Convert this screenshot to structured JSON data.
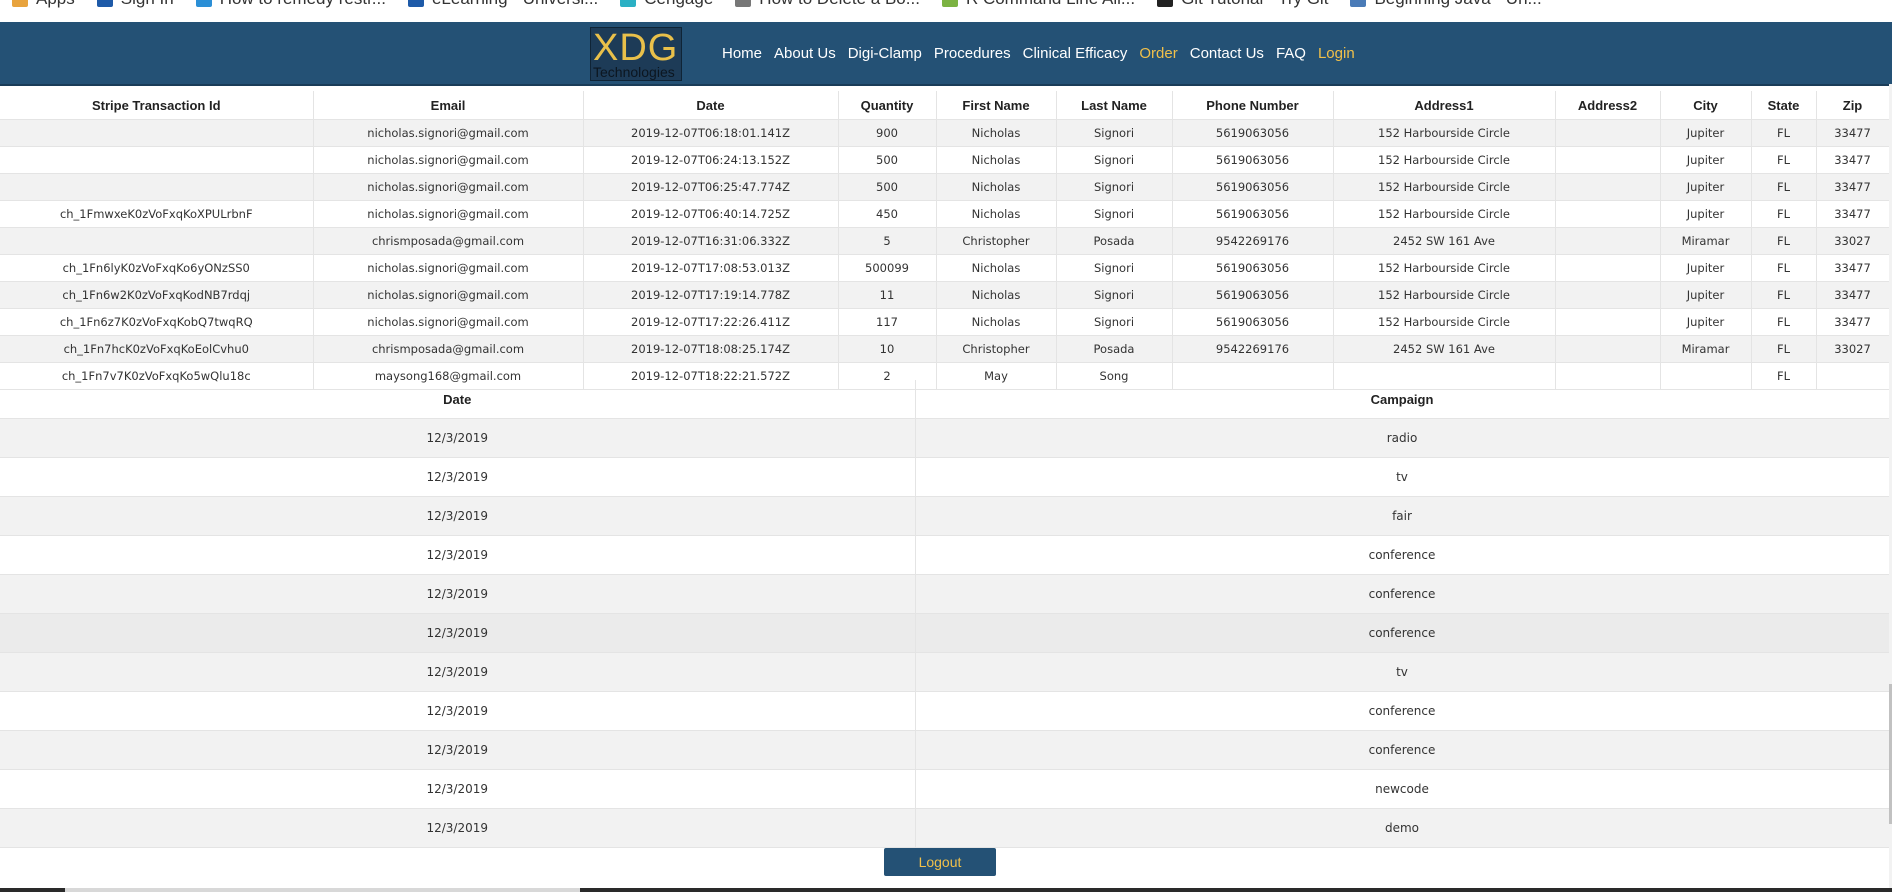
{
  "bookmarks": [
    {
      "label": "Apps",
      "icon": "apps-grid-icon",
      "color": "#e8a33d"
    },
    {
      "label": "Sign In",
      "icon": "sign-in-icon",
      "color": "#1e5aa8"
    },
    {
      "label": "How to remedy restr...",
      "icon": "windows-icon",
      "color": "#2b8fd6"
    },
    {
      "label": "eLearning - Universi...",
      "icon": "elearning-icon",
      "color": "#1e5aa8"
    },
    {
      "label": "Cengage",
      "icon": "cengage-icon",
      "color": "#2bb0c4"
    },
    {
      "label": "How to Delete a Bo...",
      "icon": "clock-icon",
      "color": "#777777"
    },
    {
      "label": "R Command Line All...",
      "icon": "chart-icon",
      "color": "#7cb342"
    },
    {
      "label": "Git Tutorial - Try Git",
      "icon": "github-icon",
      "color": "#222222"
    },
    {
      "label": "Beginning Java - Un...",
      "icon": "java-icon",
      "color": "#4a7bb7"
    }
  ],
  "navbar": {
    "logo_main": "XDG",
    "logo_sub": "Technologies",
    "links": [
      {
        "label": "Home",
        "active": false
      },
      {
        "label": "About Us",
        "active": false
      },
      {
        "label": "Digi-Clamp",
        "active": false
      },
      {
        "label": "Procedures",
        "active": false
      },
      {
        "label": "Clinical Efficacy",
        "active": false
      },
      {
        "label": "Order",
        "active": true
      },
      {
        "label": "Contact Us",
        "active": false
      },
      {
        "label": "FAQ",
        "active": false
      },
      {
        "label": "Login",
        "active": true
      }
    ],
    "colors": {
      "background": "#245175",
      "accent": "#f0c04a"
    }
  },
  "orders": {
    "headers": [
      "Stripe Transaction Id",
      "Email",
      "Date",
      "Quantity",
      "First Name",
      "Last Name",
      "Phone Number",
      "Address1",
      "Address2",
      "City",
      "State",
      "Zip"
    ],
    "rows": [
      [
        "",
        "nicholas.signori@gmail.com",
        "2019-12-07T06:18:01.141Z",
        "900",
        "Nicholas",
        "Signori",
        "5619063056",
        "152 Harbourside Circle",
        "",
        "Jupiter",
        "FL",
        "33477"
      ],
      [
        "",
        "nicholas.signori@gmail.com",
        "2019-12-07T06:24:13.152Z",
        "500",
        "Nicholas",
        "Signori",
        "5619063056",
        "152 Harbourside Circle",
        "",
        "Jupiter",
        "FL",
        "33477"
      ],
      [
        "",
        "nicholas.signori@gmail.com",
        "2019-12-07T06:25:47.774Z",
        "500",
        "Nicholas",
        "Signori",
        "5619063056",
        "152 Harbourside Circle",
        "",
        "Jupiter",
        "FL",
        "33477"
      ],
      [
        "ch_1FmwxeK0zVoFxqKoXPULrbnF",
        "nicholas.signori@gmail.com",
        "2019-12-07T06:40:14.725Z",
        "450",
        "Nicholas",
        "Signori",
        "5619063056",
        "152 Harbourside Circle",
        "",
        "Jupiter",
        "FL",
        "33477"
      ],
      [
        "",
        "chrismposada@gmail.com",
        "2019-12-07T16:31:06.332Z",
        "5",
        "Christopher",
        "Posada",
        "9542269176",
        "2452 SW 161 Ave",
        "",
        "Miramar",
        "FL",
        "33027"
      ],
      [
        "ch_1Fn6lyK0zVoFxqKo6yONzSS0",
        "nicholas.signori@gmail.com",
        "2019-12-07T17:08:53.013Z",
        "500099",
        "Nicholas",
        "Signori",
        "5619063056",
        "152 Harbourside Circle",
        "",
        "Jupiter",
        "FL",
        "33477"
      ],
      [
        "ch_1Fn6w2K0zVoFxqKodNB7rdqj",
        "nicholas.signori@gmail.com",
        "2019-12-07T17:19:14.778Z",
        "11",
        "Nicholas",
        "Signori",
        "5619063056",
        "152 Harbourside Circle",
        "",
        "Jupiter",
        "FL",
        "33477"
      ],
      [
        "ch_1Fn6z7K0zVoFxqKobQ7twqRQ",
        "nicholas.signori@gmail.com",
        "2019-12-07T17:22:26.411Z",
        "117",
        "Nicholas",
        "Signori",
        "5619063056",
        "152 Harbourside Circle",
        "",
        "Jupiter",
        "FL",
        "33477"
      ],
      [
        "ch_1Fn7hcK0zVoFxqKoEolCvhu0",
        "chrismposada@gmail.com",
        "2019-12-07T18:08:25.174Z",
        "10",
        "Christopher",
        "Posada",
        "9542269176",
        "2452 SW 161 Ave",
        "",
        "Miramar",
        "FL",
        "33027"
      ],
      [
        "ch_1Fn7v7K0zVoFxqKo5wQlu18c",
        "maysong168@gmail.com",
        "2019-12-07T18:22:21.572Z",
        "2",
        "May",
        "Song",
        "",
        "",
        "",
        "",
        "FL",
        ""
      ]
    ]
  },
  "campaigns": {
    "headers": [
      "Date",
      "Campaign"
    ],
    "rows": [
      [
        "12/3/2019",
        "radio"
      ],
      [
        "12/3/2019",
        "tv"
      ],
      [
        "12/3/2019",
        "fair"
      ],
      [
        "12/3/2019",
        "conference"
      ],
      [
        "12/3/2019",
        "conference"
      ],
      [
        "12/3/2019",
        "conference"
      ],
      [
        "12/3/2019",
        "tv"
      ],
      [
        "12/3/2019",
        "conference"
      ],
      [
        "12/3/2019",
        "conference"
      ],
      [
        "12/3/2019",
        "newcode"
      ],
      [
        "12/3/2019",
        "demo"
      ]
    ]
  },
  "logout_label": "Logout"
}
